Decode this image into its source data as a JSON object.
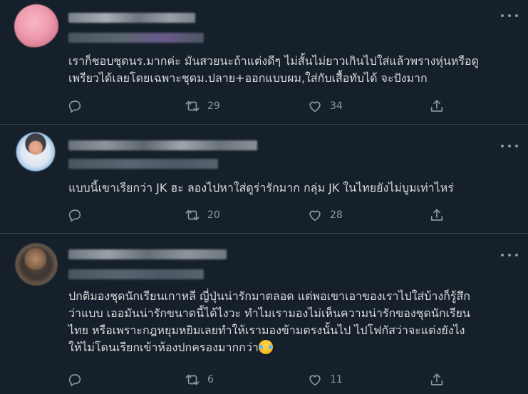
{
  "colors": {
    "background": "#15202b",
    "divider": "#38444d",
    "text": "#d9d9d9",
    "muted": "#8899a6"
  },
  "tweets": [
    {
      "avatar": "blurred-pink-avatar",
      "text": "เราก็ชอบชุดนร.มากค่ะ มันสวยนะถ้าแต่งดีๆ ไม่สั้นไม่ยาวเกินไปใส่แล้วพรางหุ่นหรือดู\nเพรียวได้เลยโดยเฉพาะชุดม.ปลาย+ออกแบบผม,ใส่กับเสื้อทับได้ จะปังมาก",
      "reply_count": "",
      "retweet_count": "29",
      "like_count": "34"
    },
    {
      "avatar": "blurred-person-avatar",
      "text": "แบบนี้เขาเรียกว่า JK ฮะ ลองไปหาใส่ดูร่ารักมาก กลุ่ม JK ในไทยยังไม่บูมเท่าไหร่",
      "reply_count": "",
      "retweet_count": "20",
      "like_count": "28"
    },
    {
      "avatar": "blurred-dark-avatar",
      "text": "ปกติมองชุดนักเรียนเกาหลี ญี่ปุ่นน่ารักมาตลอด แต่พอเขาเอาของเราไปใส่บ้างก็รู้สึก\nว่าแบบ เออมันน่ารักขนาดนี้ได้ไงวะ ทำไมเรามองไม่เห็นความน่ารักของชุดนักเรียน\nไทย หรือเพราะกฎหยุมหยิมเลยทำให้เรามองข้ามตรงนั้นไป ไปโฟกัสว่าจะแต่งยังไง\nให้ไม่โดนเรียกเข้าห้องปกครองมากกว่า",
      "emoji": "face-with-tears-of-joy",
      "reply_count": "",
      "retweet_count": "6",
      "like_count": "11"
    }
  ]
}
